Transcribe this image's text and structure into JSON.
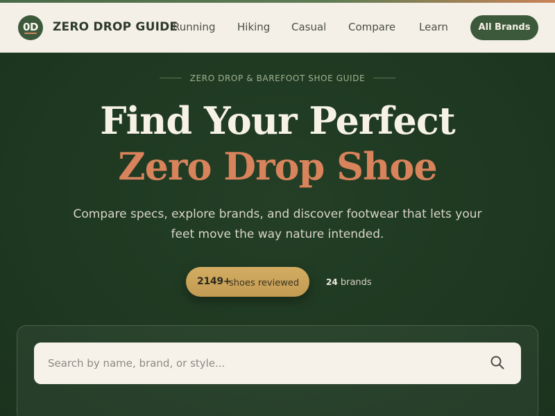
{
  "header": {
    "logo_text": "0D",
    "brand_name": "ZERO DROP GUIDE",
    "nav": [
      {
        "label": "Running"
      },
      {
        "label": "Hiking"
      },
      {
        "label": "Casual"
      },
      {
        "label": "Compare"
      },
      {
        "label": "Learn"
      }
    ],
    "cta_label": "All Brands"
  },
  "hero": {
    "eyebrow": "ZERO DROP & BAREFOOT SHOE GUIDE",
    "headline_line1": "Find Your Perfect",
    "headline_line2": "Zero Drop Shoe",
    "subtitle": "Compare specs, explore brands, and discover footwear that lets your feet move the way nature intended.",
    "stats": {
      "shoes_count": "2149+",
      "shoes_label": "shoes reviewed",
      "brands_count": "24",
      "brands_label": "brands"
    }
  },
  "search": {
    "placeholder": "Search by name, brand, or style..."
  },
  "colors": {
    "nav_bg": "#f4f0e7",
    "hero_bg": "#1f3a22",
    "accent_green": "#3c5a3b",
    "accent_orange": "#d8835b",
    "stat_gold": "#d2ad62",
    "headline_cream": "#f7f2e6"
  }
}
